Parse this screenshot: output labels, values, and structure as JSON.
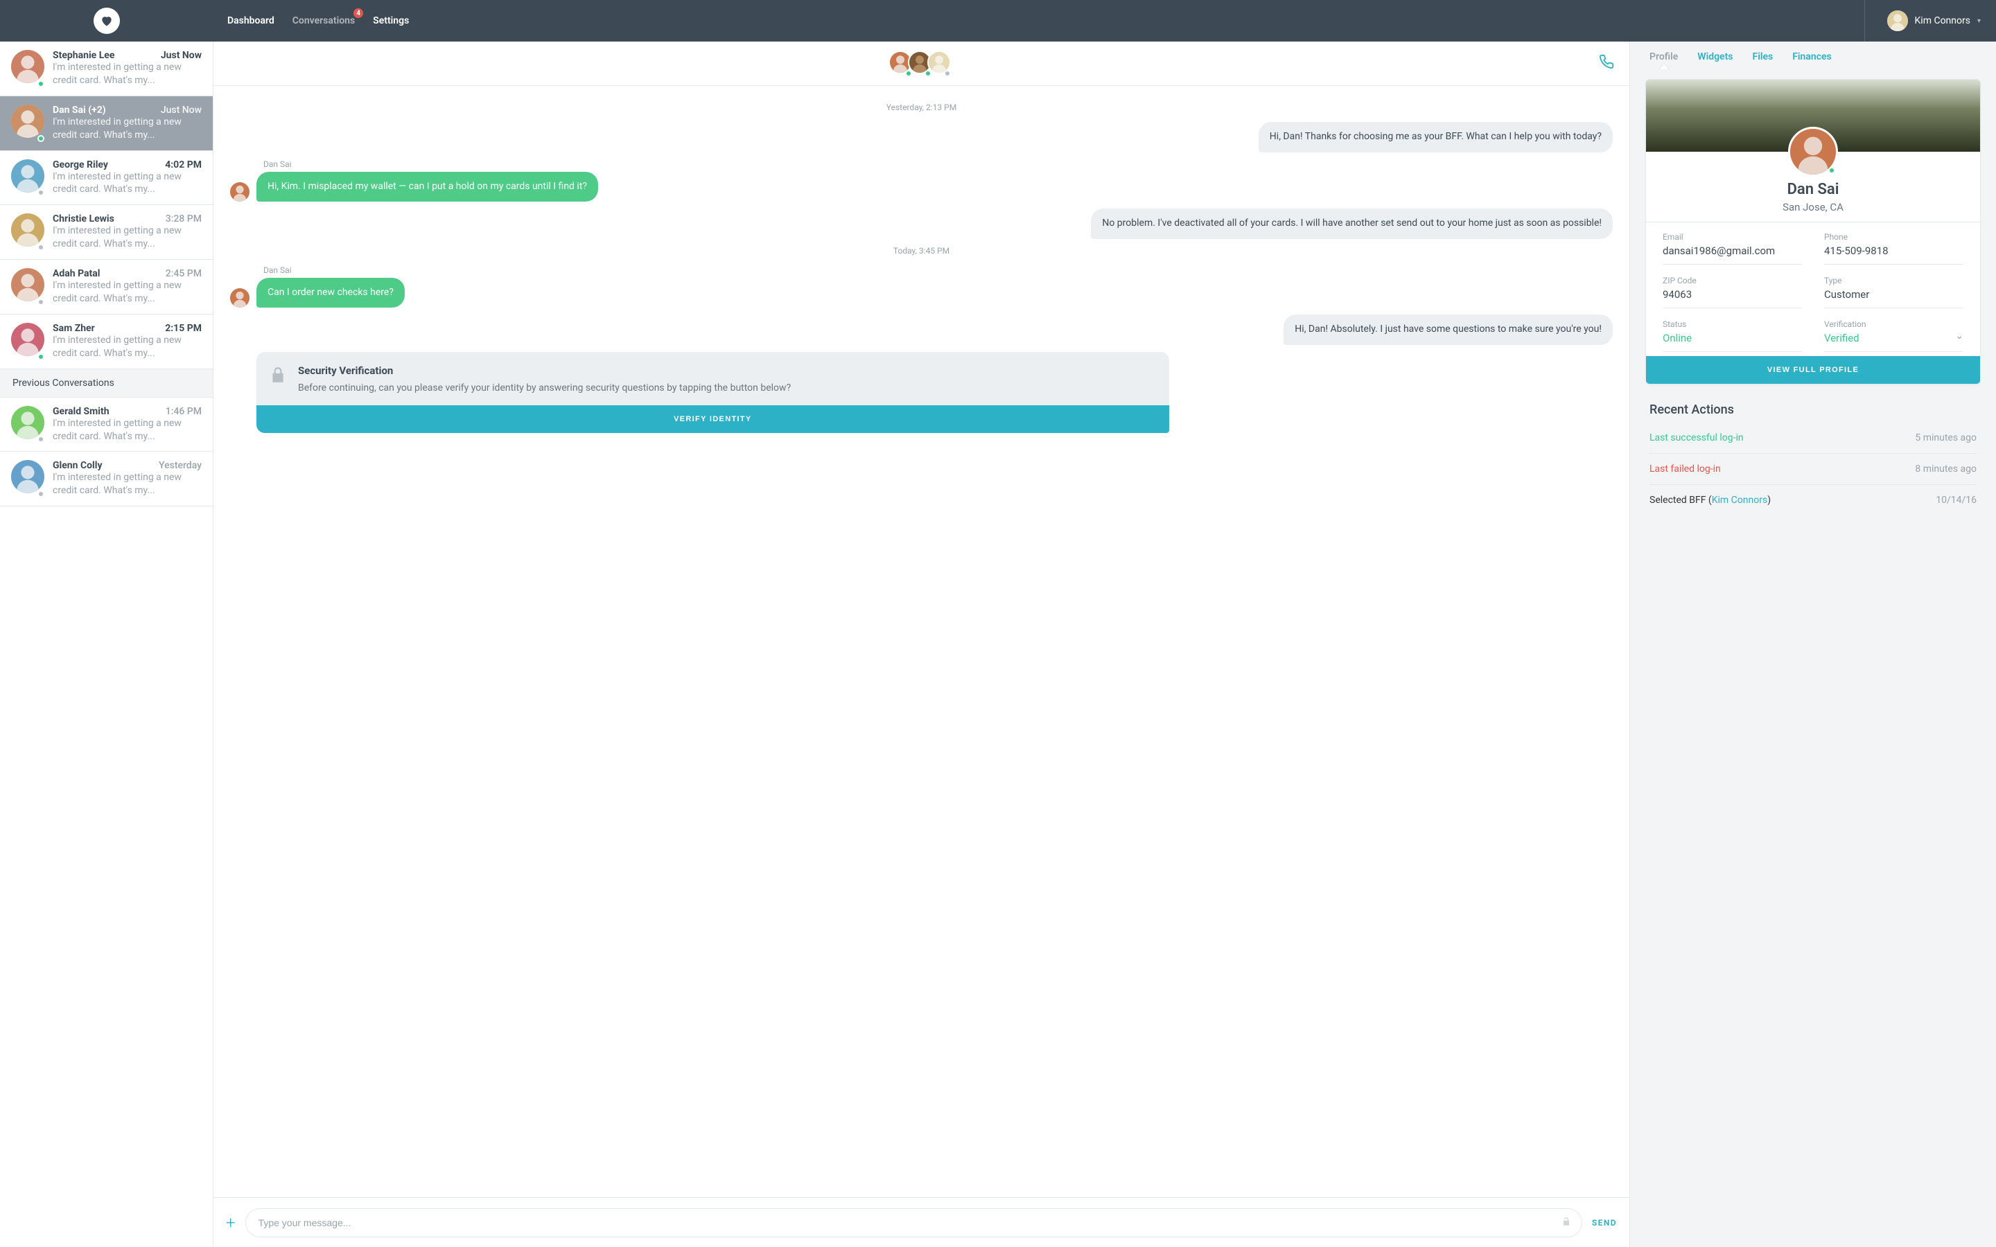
{
  "header": {
    "nav": {
      "dashboard": "Dashboard",
      "conversations": "Conversations",
      "settings": "Settings",
      "badge": "4"
    },
    "user_name": "Kim Connors"
  },
  "sidebar": {
    "prev_header": "Previous Conversations",
    "items": [
      {
        "name": "Stephanie Lee",
        "time": "Just Now",
        "preview": "I'm interested in getting a new credit card. What's my...",
        "status": "online",
        "bold": true,
        "hue": 15
      },
      {
        "name": "Dan Sai (+2)",
        "time": "Just Now",
        "preview": "I'm interested in getting a new credit card. What's my...",
        "status": "online",
        "selected": true,
        "hue": 25
      },
      {
        "name": "George Riley",
        "time": "4:02 PM",
        "preview": "I'm interested in getting a new credit card. What's my...",
        "status": "offline",
        "bold": true,
        "hue": 200
      },
      {
        "name": "Christie Lewis",
        "time": "3:28 PM",
        "preview": "I'm interested in getting a new credit card. What's my...",
        "status": "offline",
        "hue": 40
      },
      {
        "name": "Adah Patal",
        "time": "2:45 PM",
        "preview": "I'm interested in getting a new credit card. What's my...",
        "status": "offline",
        "hue": 20
      },
      {
        "name": "Sam Zher",
        "time": "2:15 PM",
        "preview": "I'm interested in getting a new credit card. What's my...",
        "status": "online",
        "bold": true,
        "hue": 350
      }
    ],
    "prev": [
      {
        "name": "Gerald Smith",
        "time": "1:46 PM",
        "preview": "I'm interested in getting a new credit card. What's my...",
        "status": "offline",
        "hue": 110
      },
      {
        "name": "Glenn Colly",
        "time": "Yesterday",
        "preview": "I'm interested in getting a new credit card. What's my...",
        "status": "offline",
        "hue": 205
      }
    ]
  },
  "chat": {
    "day1": "Yesterday, 2:13 PM",
    "msg1": "Hi, Dan! Thanks for choosing me as your BFF. What can I help you with today?",
    "sender1": "Dan Sai",
    "msg2": "Hi, Kim. I misplaced my wallet — can I put a hold on my cards until I find it?",
    "msg3": "No problem. I've deactivated all of your cards. I will have another set send out to your home just as soon as possible!",
    "day2": "Today, 3:45 PM",
    "sender2": "Dan Sai",
    "msg4": "Can I order new checks here?",
    "msg5": "Hi, Dan! Absolutely. I just have some questions to make sure you're you!",
    "verify_title": "Security Verification",
    "verify_body": "Before continuing, can you please verify your identity by answering security questions by tapping the button below?",
    "verify_btn": "VERIFY IDENTITY",
    "placeholder": "Type your message...",
    "send": "SEND"
  },
  "profile": {
    "tabs": {
      "profile": "Profile",
      "widgets": "Widgets",
      "files": "Files",
      "finances": "Finances"
    },
    "name": "Dan Sai",
    "location": "San Jose, CA",
    "fields": {
      "email_l": "Email",
      "email": "dansai1986@gmail.com",
      "phone_l": "Phone",
      "phone": "415-509-9818",
      "zip_l": "ZIP Code",
      "zip": "94063",
      "type_l": "Type",
      "type": "Customer",
      "status_l": "Status",
      "status": "Online",
      "verif_l": "Verification",
      "verif": "Verified"
    },
    "view_btn": "VIEW FULL PROFILE",
    "recent_title": "Recent Actions",
    "actions": {
      "a0_label": "Last successful log-in",
      "a0_when": "5 minutes ago",
      "a1_label": "Last failed log-in",
      "a1_when": "8 minutes ago",
      "a2_pre": "Selected BFF (",
      "a2_link": "Kim Connors",
      "a2_post": ")",
      "a2_when": "10/14/16"
    }
  }
}
